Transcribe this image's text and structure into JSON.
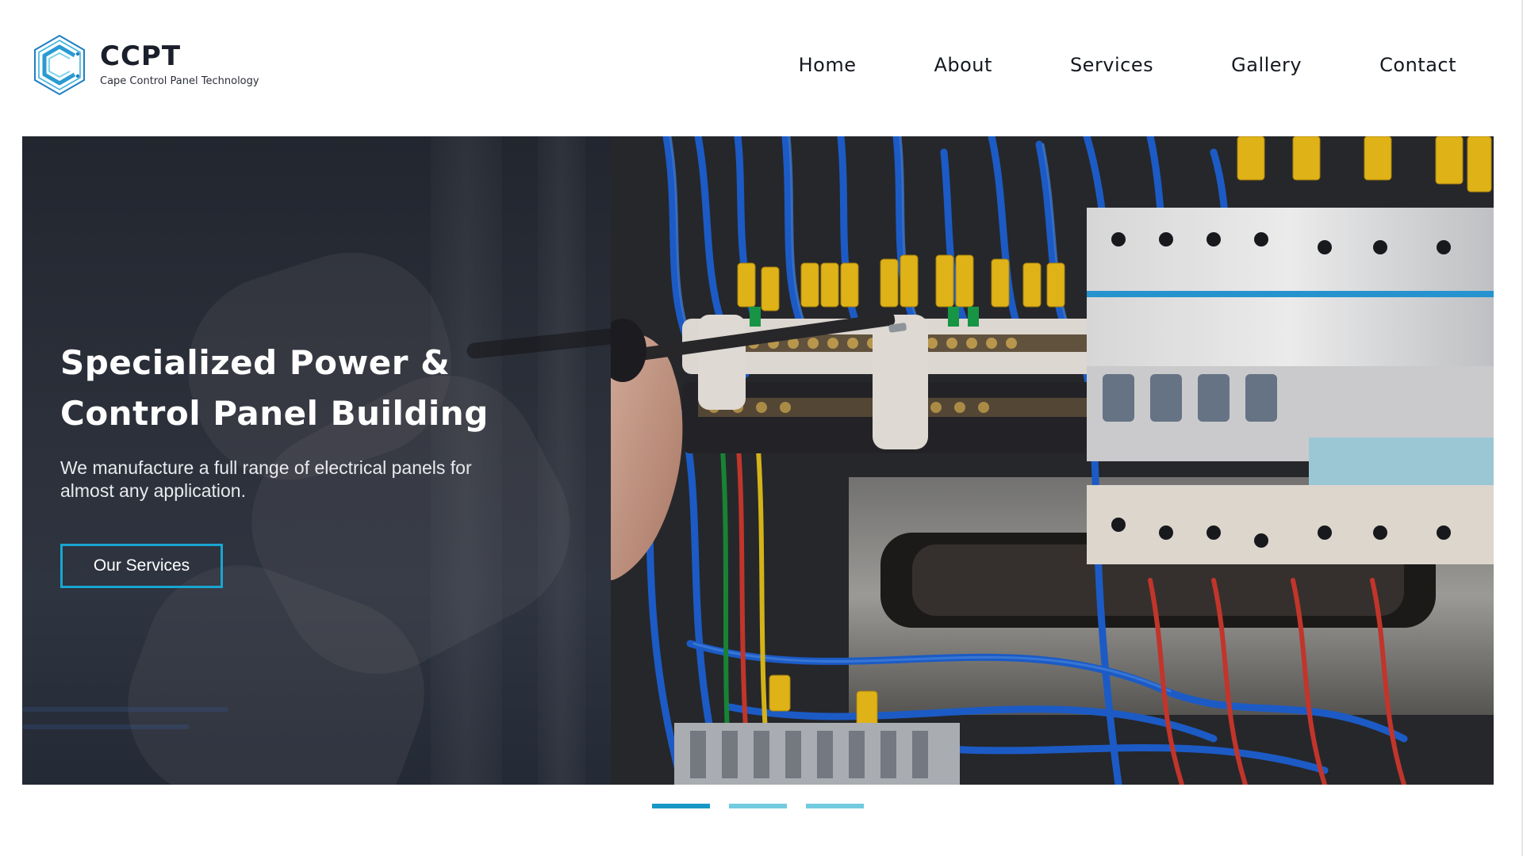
{
  "brand": {
    "name": "CCPT",
    "tagline": "Cape Control Panel Technology",
    "logo_icon": "ccpt-hex-c-logo",
    "accent_color": "#19a6d0"
  },
  "nav": {
    "items": [
      {
        "label": "Home"
      },
      {
        "label": "About"
      },
      {
        "label": "Services"
      },
      {
        "label": "Gallery"
      },
      {
        "label": "Contact"
      }
    ]
  },
  "hero": {
    "title_line1": "Specialized Power &",
    "title_line2": "Control Panel Building",
    "subtitle": "We manufacture a full range of electrical panels for almost any application.",
    "cta_label": "Our Services",
    "image": "electrician-wiring-control-panel-photo"
  },
  "slider": {
    "slide_count": 3,
    "active_index": 0,
    "active_color": "#1897c5",
    "inactive_color": "#72cbe0"
  }
}
